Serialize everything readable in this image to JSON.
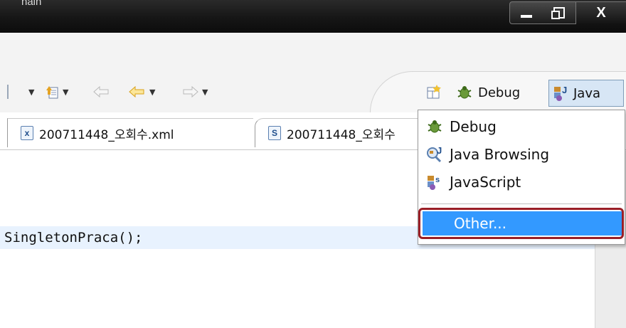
{
  "window": {
    "title_partial": "nain",
    "minimize_label": "_",
    "maximize_label": "",
    "close_label": "X"
  },
  "toolbar": {
    "items": [
      {
        "icon": "separator-icon",
        "glyph": "▏"
      },
      {
        "icon": "dropdown-arrow-icon",
        "glyph": "▾"
      },
      {
        "icon": "import-icon",
        "glyph": "⇪"
      },
      {
        "icon": "dropdown-arrow-icon",
        "glyph": "▾"
      },
      {
        "icon": "back-history-icon",
        "glyph": "⇦"
      },
      {
        "icon": "nav-back-icon",
        "glyph": "⇦"
      },
      {
        "icon": "dropdown-arrow-icon",
        "glyph": "▾"
      },
      {
        "icon": "nav-forward-icon",
        "glyph": "⇨"
      },
      {
        "icon": "dropdown-arrow-icon",
        "glyph": "▾"
      }
    ]
  },
  "perspectives": {
    "open_perspective_icon": "open-perspective-icon",
    "debug_label": "Debug",
    "java_label": "Java"
  },
  "tabs": [
    {
      "label": "200711448_오회수.xml",
      "icon_letter": "x"
    },
    {
      "label": "200711448_오회수",
      "icon_letter": "S"
    }
  ],
  "editor": {
    "code_line": "SingletonPraca();"
  },
  "menu": {
    "items": [
      {
        "label": "Debug",
        "icon": "debug-bug-icon"
      },
      {
        "label": "Java Browsing",
        "icon": "java-browsing-icon"
      },
      {
        "label": "JavaScript",
        "icon": "javascript-icon"
      }
    ],
    "other_label": "Other..."
  },
  "colors": {
    "highlight": "#3399ff",
    "annotation_border": "#9a1f27",
    "selected_perspective": "#d7e6f5"
  }
}
